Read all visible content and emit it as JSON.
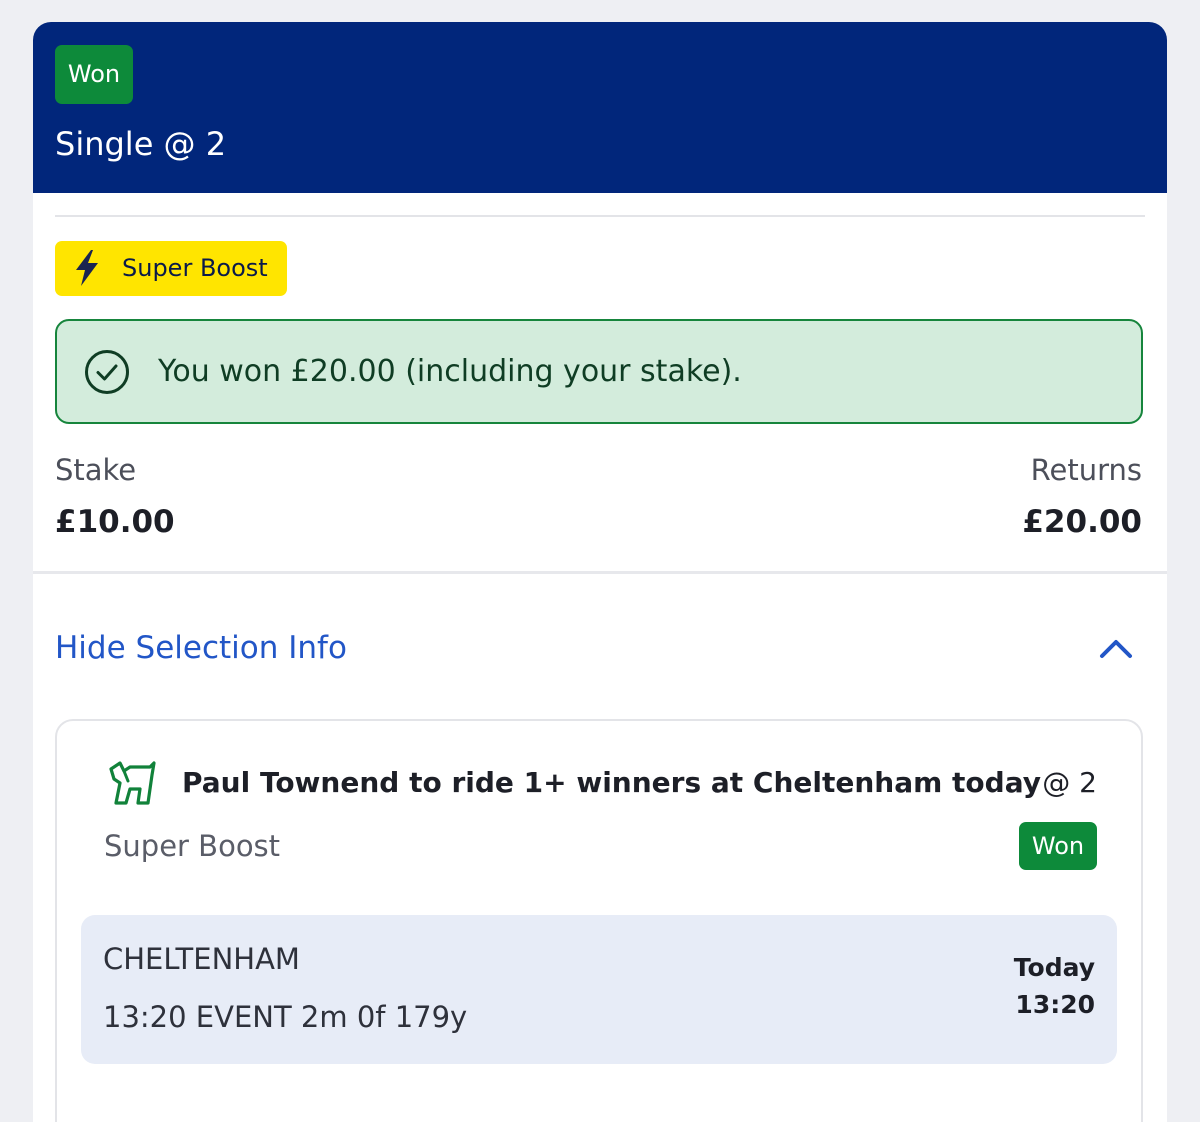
{
  "bet": {
    "status": "Won",
    "title": "Single @ 2"
  },
  "boost": {
    "label": "Super Boost",
    "icon": "lightning-bolt-icon"
  },
  "result_banner": {
    "message": "You won £20.00 (including your stake).",
    "icon": "check-circle-icon"
  },
  "amounts": {
    "stake_label": "Stake",
    "stake_value": "£10.00",
    "returns_label": "Returns",
    "returns_value": "£20.00"
  },
  "selection_toggle": {
    "label": "Hide Selection Info",
    "icon": "chevron-up-icon"
  },
  "selection": {
    "icon": "horse-racing-icon",
    "title": "Paul Townend to ride 1+ winners at Cheltenham today",
    "odds": "@ 2",
    "subtitle": "Super Boost",
    "status": "Won",
    "event": {
      "venue": "CHELTENHAM",
      "detail": "13:20 EVENT 2m 0f 179y",
      "day": "Today",
      "time": "13:20"
    }
  },
  "colors": {
    "header": "#01267b",
    "won": "#0d8a3a",
    "boost": "#ffe500",
    "banner_bg": "#d3ecdc",
    "banner_border": "#16853c",
    "link": "#2256c7",
    "event_bg": "#e7ecf7"
  }
}
